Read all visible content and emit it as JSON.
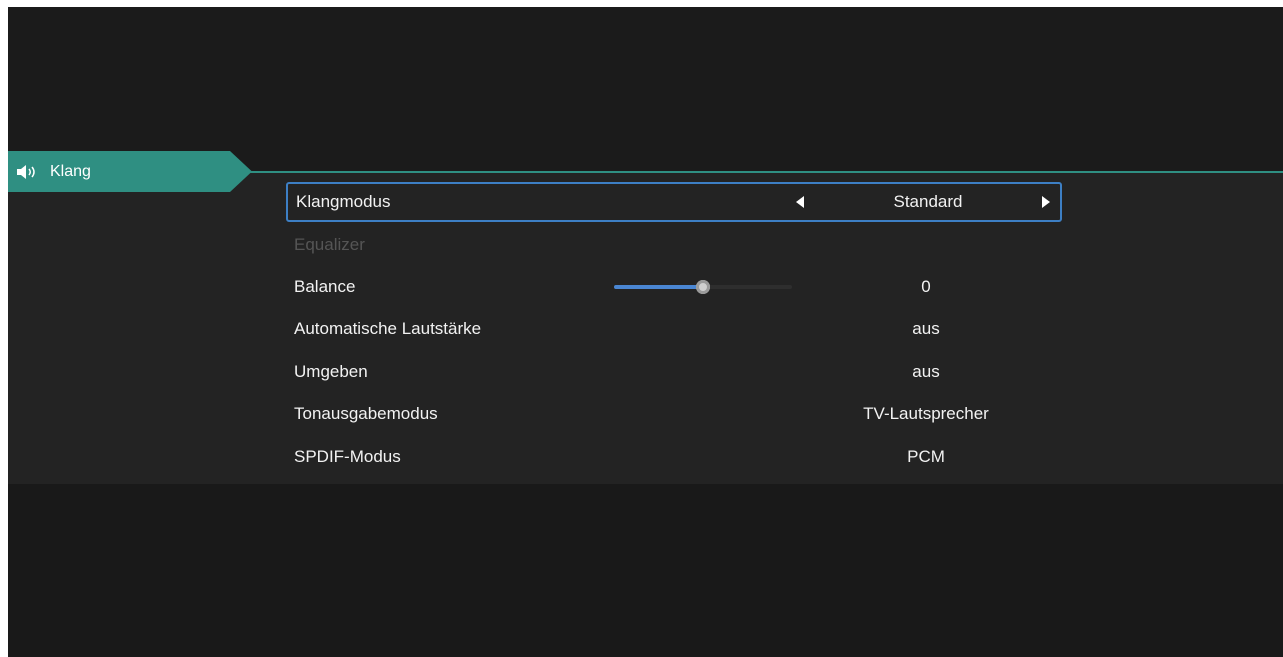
{
  "category": {
    "icon": "speaker-icon",
    "label": "Klang"
  },
  "colors": {
    "accent": "#2f8f82",
    "focus": "#3d7fc4",
    "slider_fill": "#4a86d2"
  },
  "settings": [
    {
      "label": "Klangmodus",
      "value": "Standard"
    },
    {
      "label": "Equalizer",
      "value": ""
    },
    {
      "label": "Balance",
      "value": "0",
      "slider_level": 0.5
    },
    {
      "label": "Automatische Lautstärke",
      "value": "aus"
    },
    {
      "label": "Umgeben",
      "value": "aus"
    },
    {
      "label": "Tonausgabemodus",
      "value": "TV-Lautsprecher"
    },
    {
      "label": "SPDIF-Modus",
      "value": "PCM"
    }
  ]
}
